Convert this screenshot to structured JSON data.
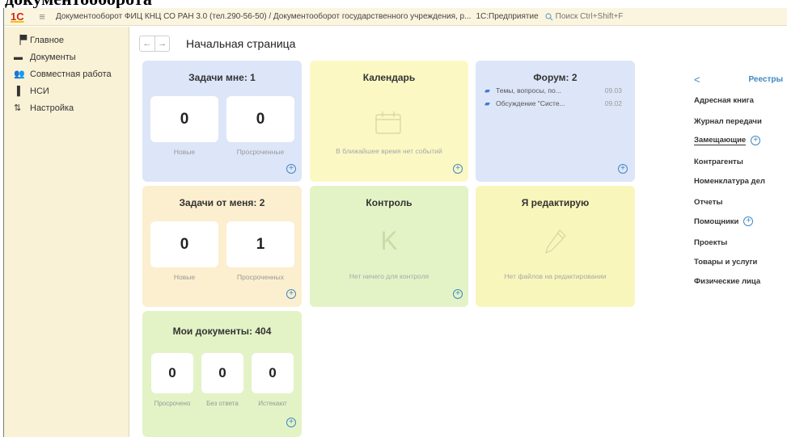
{
  "background_heading": "документооборота",
  "titlebar": {
    "logo": "1С",
    "menu_icon": "hamburger-icon",
    "title": "Документооборот ФИЦ КНЦ СО РАН 3.0 (тел.290-56-50) / Документооборот государственного учреждения, р...",
    "app": "1С:Предприятие",
    "search_placeholder": "Поиск Ctrl+Shift+F"
  },
  "sidebar": {
    "items": [
      {
        "label": "Главное",
        "icon": "flag-icon"
      },
      {
        "label": "Документы",
        "icon": "folder-icon"
      },
      {
        "label": "Совместная работа",
        "icon": "people-icon"
      },
      {
        "label": "НСИ",
        "icon": "book-icon"
      },
      {
        "label": "Настройка",
        "icon": "settings-icon"
      }
    ]
  },
  "nav": {
    "back": "←",
    "forward": "→",
    "title": "Начальная страница"
  },
  "cards": {
    "tasks_to_me": {
      "title": "Задачи мне: 1",
      "new_value": "0",
      "new_label": "Новые",
      "overdue_value": "0",
      "overdue_label": "Просроченные",
      "color": "#dde6f8"
    },
    "calendar": {
      "title": "Календарь",
      "empty": "В ближайшее время нет событий",
      "color": "#fbf8c4"
    },
    "forum": {
      "title": "Форум: 2",
      "items": [
        {
          "text": "Темы, вопросы, по...",
          "date": "09.03"
        },
        {
          "text": "Обсуждение \"Систе...",
          "date": "09.02"
        }
      ],
      "color": "#dde6f8"
    },
    "tasks_from_me": {
      "title": "Задачи от меня: 2",
      "new_value": "0",
      "new_label": "Новые",
      "overdue_value": "1",
      "overdue_label": "Просроченных",
      "color": "#fcefcf"
    },
    "control": {
      "title": "Контроль",
      "empty": "Нет ничего для контроля",
      "icon_glyph": "K",
      "color": "#e3f3c6"
    },
    "editing": {
      "title": "Я редактирую",
      "empty": "Нет файлов на редактировании",
      "color": "#f9f6bc"
    },
    "my_docs": {
      "title": "Мои документы: 404",
      "overdue_value": "0",
      "overdue_label": "Просрочено",
      "noanswer_value": "0",
      "noanswer_label": "Без ответа",
      "expiring_value": "0",
      "expiring_label": "Истекают",
      "color": "#e3f3c6"
    }
  },
  "registers": {
    "back": "<",
    "title": "Реестры",
    "items": [
      "Адресная книга",
      "Журнал передачи",
      "Замещающие",
      "Контрагенты",
      "Номенклатура дел",
      "Отчеты",
      "Помощники",
      "Проекты",
      "Товары и услуги",
      "Физические лица"
    ],
    "plus": "+"
  }
}
